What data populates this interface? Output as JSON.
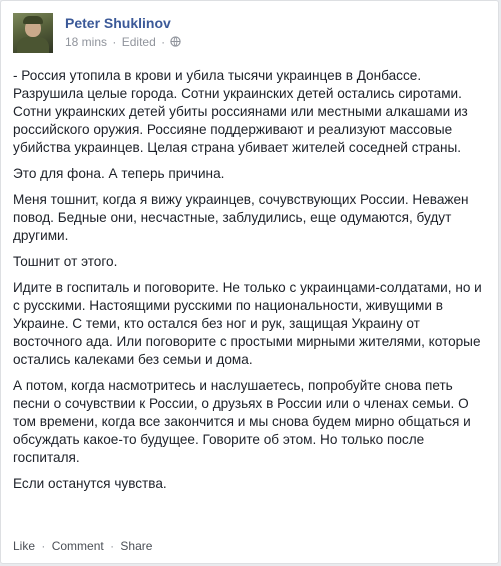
{
  "post": {
    "author": "Peter Shuklinov",
    "time": "18 mins",
    "edited": "Edited",
    "separator": "·",
    "privacy_icon": "globe-icon",
    "paragraphs": [
      "- Россия утопила в крови и убила тысячи украинцев в Донбассе. Разрушила целые города. Сотни украинских детей остались сиротами. Сотни украинских детей убиты россиянами или местными алкашами из российского оружия. Россияне поддерживают и реализуют массовые убийства украинцев. Целая страна убивает жителей соседней страны.",
      "Это для фона. А теперь причина.",
      "Меня тошнит, когда я вижу украинцев, сочувствующих России. Неважен повод. Бедные они, несчастные, заблудились, еще одумаются, будут другими.",
      "Тошнит от этого.",
      "Идите в госпиталь и поговорите. Не только с украинцами-солдатами, но и с русскими. Настоящими русскими по национальности, живущими в Украине. С теми, кто остался без ног и рук, защищая Украину от восточного ада. Или поговорите с простыми мирными жителями, которые остались калеками без семьи и дома.",
      "А потом, когда насмотритесь и наслушаетесь, попробуйте снова петь песни о сочувствии к России, о друзьях в России или о членах семьи. О том времени, когда все закончится и мы снова будем мирно общаться и обсуждать какое-то будущее. Говорите об этом. Но только после госпиталя.",
      "Если останутся чувства."
    ]
  },
  "actions": {
    "like": "Like",
    "comment": "Comment",
    "share": "Share",
    "separator": "·"
  },
  "colors": {
    "author": "#3b5998",
    "meta": "#90949c",
    "text": "#1d2129"
  }
}
